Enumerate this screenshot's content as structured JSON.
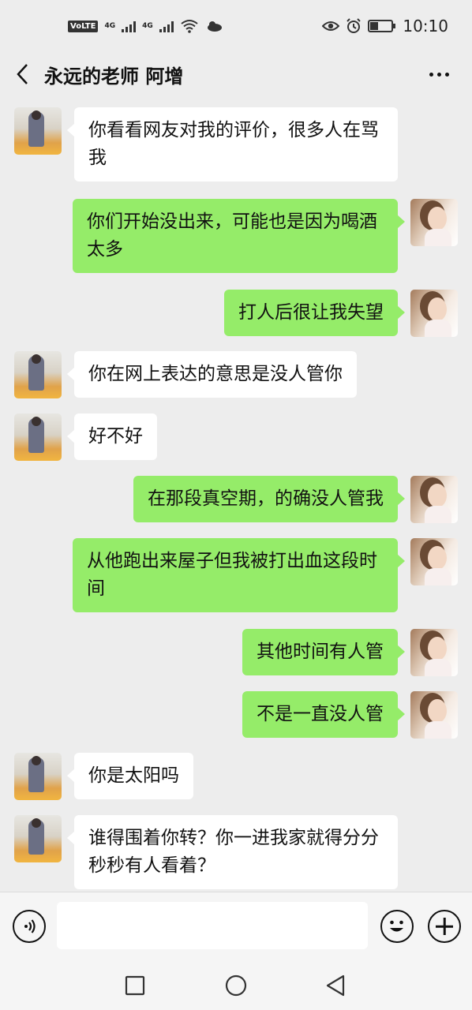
{
  "status_bar": {
    "volte": "VoLTE",
    "signal1": "4G",
    "signal2": "4G",
    "time": "10:10",
    "battery_level": 0.4,
    "icons": [
      "signal-icon",
      "wifi-icon",
      "weather-icon",
      "eye-icon",
      "alarm-icon",
      "battery-icon"
    ]
  },
  "header": {
    "title": "永远的老师 阿增",
    "back_icon": "chevron-left-icon",
    "more_icon": "more-horizontal-icon"
  },
  "messages": [
    {
      "side": "in",
      "text": "你看看网友对我的评价，很多人在骂我"
    },
    {
      "side": "out",
      "text": "你们开始没出来，可能也是因为喝酒太多"
    },
    {
      "side": "out",
      "text": "打人后很让我失望"
    },
    {
      "side": "in",
      "text": "你在网上表达的意思是没人管你"
    },
    {
      "side": "in",
      "text": "好不好"
    },
    {
      "side": "out",
      "text": "在那段真空期，的确没人管我"
    },
    {
      "side": "out",
      "text": "从他跑出来屋子但我被打出血这段时间"
    },
    {
      "side": "out",
      "text": "其他时间有人管"
    },
    {
      "side": "out",
      "text": "不是一直没人管"
    },
    {
      "side": "in",
      "text": "你是太阳吗"
    },
    {
      "side": "in",
      "text": "谁得围着你转？你一进我家就得分分秒秒有人看着？"
    }
  ],
  "input_bar": {
    "placeholder": "",
    "voice_icon": "voice-icon",
    "emoji_icon": "emoji-icon",
    "plus_icon": "plus-icon"
  },
  "nav_bar": {
    "icons": [
      "square-recents-icon",
      "circle-home-icon",
      "triangle-back-icon"
    ]
  },
  "colors": {
    "background": "#ededed",
    "bubble_out": "#95ec69",
    "bubble_in": "#ffffff"
  }
}
